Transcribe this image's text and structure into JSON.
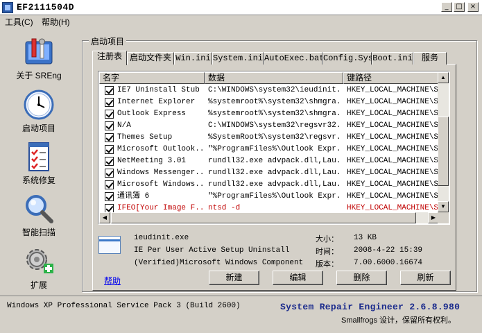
{
  "window": {
    "title": "EF2111504D",
    "controls": {
      "minimize": "_",
      "maximize": "□",
      "close": "×"
    }
  },
  "menu": [
    {
      "label": "工具(C)"
    },
    {
      "label": "帮助(H)"
    }
  ],
  "nav": [
    {
      "label": "关于 SREng",
      "icon": "toolbox-icon"
    },
    {
      "label": "启动项目",
      "icon": "clock-icon"
    },
    {
      "label": "系统修复",
      "icon": "checklist-icon"
    },
    {
      "label": "智能扫描",
      "icon": "magnifier-icon"
    },
    {
      "label": "扩展",
      "icon": "gear-plus-icon"
    }
  ],
  "group_title": "启动项目",
  "tabs": [
    "注册表",
    "启动文件夹",
    "Win.ini",
    "System.ini",
    "AutoExec.bat",
    "Config.Sys",
    "Boot.ini",
    "服务"
  ],
  "columns": [
    "名字",
    "数据",
    "键路径"
  ],
  "rows": [
    {
      "name": "IE7 Uninstall Stub",
      "data": "C:\\WINDOWS\\system32\\ieudinit...",
      "key": "HKEY_LOCAL_MACHINE\\SOF",
      "checked": true,
      "red": false
    },
    {
      "name": "Internet Explorer",
      "data": "%systemroot%\\system32\\shmgra...",
      "key": "HKEY_LOCAL_MACHINE\\SOF",
      "checked": true,
      "red": false
    },
    {
      "name": "Outlook Express",
      "data": "%systemroot%\\system32\\shmgra...",
      "key": "HKEY_LOCAL_MACHINE\\SOF",
      "checked": true,
      "red": false
    },
    {
      "name": "N/A",
      "data": "C:\\WINDOWS\\system32\\regsvr32...",
      "key": "HKEY_LOCAL_MACHINE\\SOF",
      "checked": true,
      "red": false
    },
    {
      "name": "Themes Setup",
      "data": "%SystemRoot%\\system32\\regsvr...",
      "key": "HKEY_LOCAL_MACHINE\\SOF",
      "checked": true,
      "red": false
    },
    {
      "name": "Microsoft Outlook...",
      "data": "\"%ProgramFiles%\\Outlook Expr...",
      "key": "HKEY_LOCAL_MACHINE\\SOF",
      "checked": true,
      "red": false
    },
    {
      "name": "NetMeeting 3.01",
      "data": "rundll32.exe advpack.dll,Lau...",
      "key": "HKEY_LOCAL_MACHINE\\SOF",
      "checked": true,
      "red": false
    },
    {
      "name": "Windows Messenger...",
      "data": "rundll32.exe advpack.dll,Lau...",
      "key": "HKEY_LOCAL_MACHINE\\SOF",
      "checked": true,
      "red": false
    },
    {
      "name": "Microsoft Windows...",
      "data": "rundll32.exe advpack.dll,Lau...",
      "key": "HKEY_LOCAL_MACHINE\\SOF",
      "checked": true,
      "red": false
    },
    {
      "name": "通讯簿 6",
      "data": "\"%ProgramFiles%\\Outlook Expr...",
      "key": "HKEY_LOCAL_MACHINE\\SOF",
      "checked": true,
      "red": false
    },
    {
      "name": "IFEO[Your Image F...",
      "data": "ntsd -d",
      "key": "HKEY_LOCAL_MACHINE\\SOF",
      "checked": true,
      "red": true
    }
  ],
  "detail": {
    "filename": "ieudinit.exe",
    "description": "IE Per User Active Setup Uninstall",
    "company": "(Verified)Microsoft Windows Component",
    "size_label": "大小：",
    "size_value": "13 KB",
    "time_label": "时间：",
    "time_value": "2008-4-22 15:39",
    "version_label": "版本：",
    "version_value": "7.00.6000.16674"
  },
  "help_link": "帮助",
  "buttons": {
    "new": "新建",
    "edit": "编辑",
    "delete": "删除",
    "refresh": "刷新"
  },
  "status": {
    "os": "Windows XP Professional Service Pack 3 (Build 2600)",
    "product": "System Repair Engineer 2.6.8.980",
    "copyright": "Smallfrogs 设计，保留所有权利。"
  },
  "colors": {
    "highlight_red": "#c00000",
    "brand_blue": "#1a2a8c",
    "link_blue": "#0000ee"
  }
}
